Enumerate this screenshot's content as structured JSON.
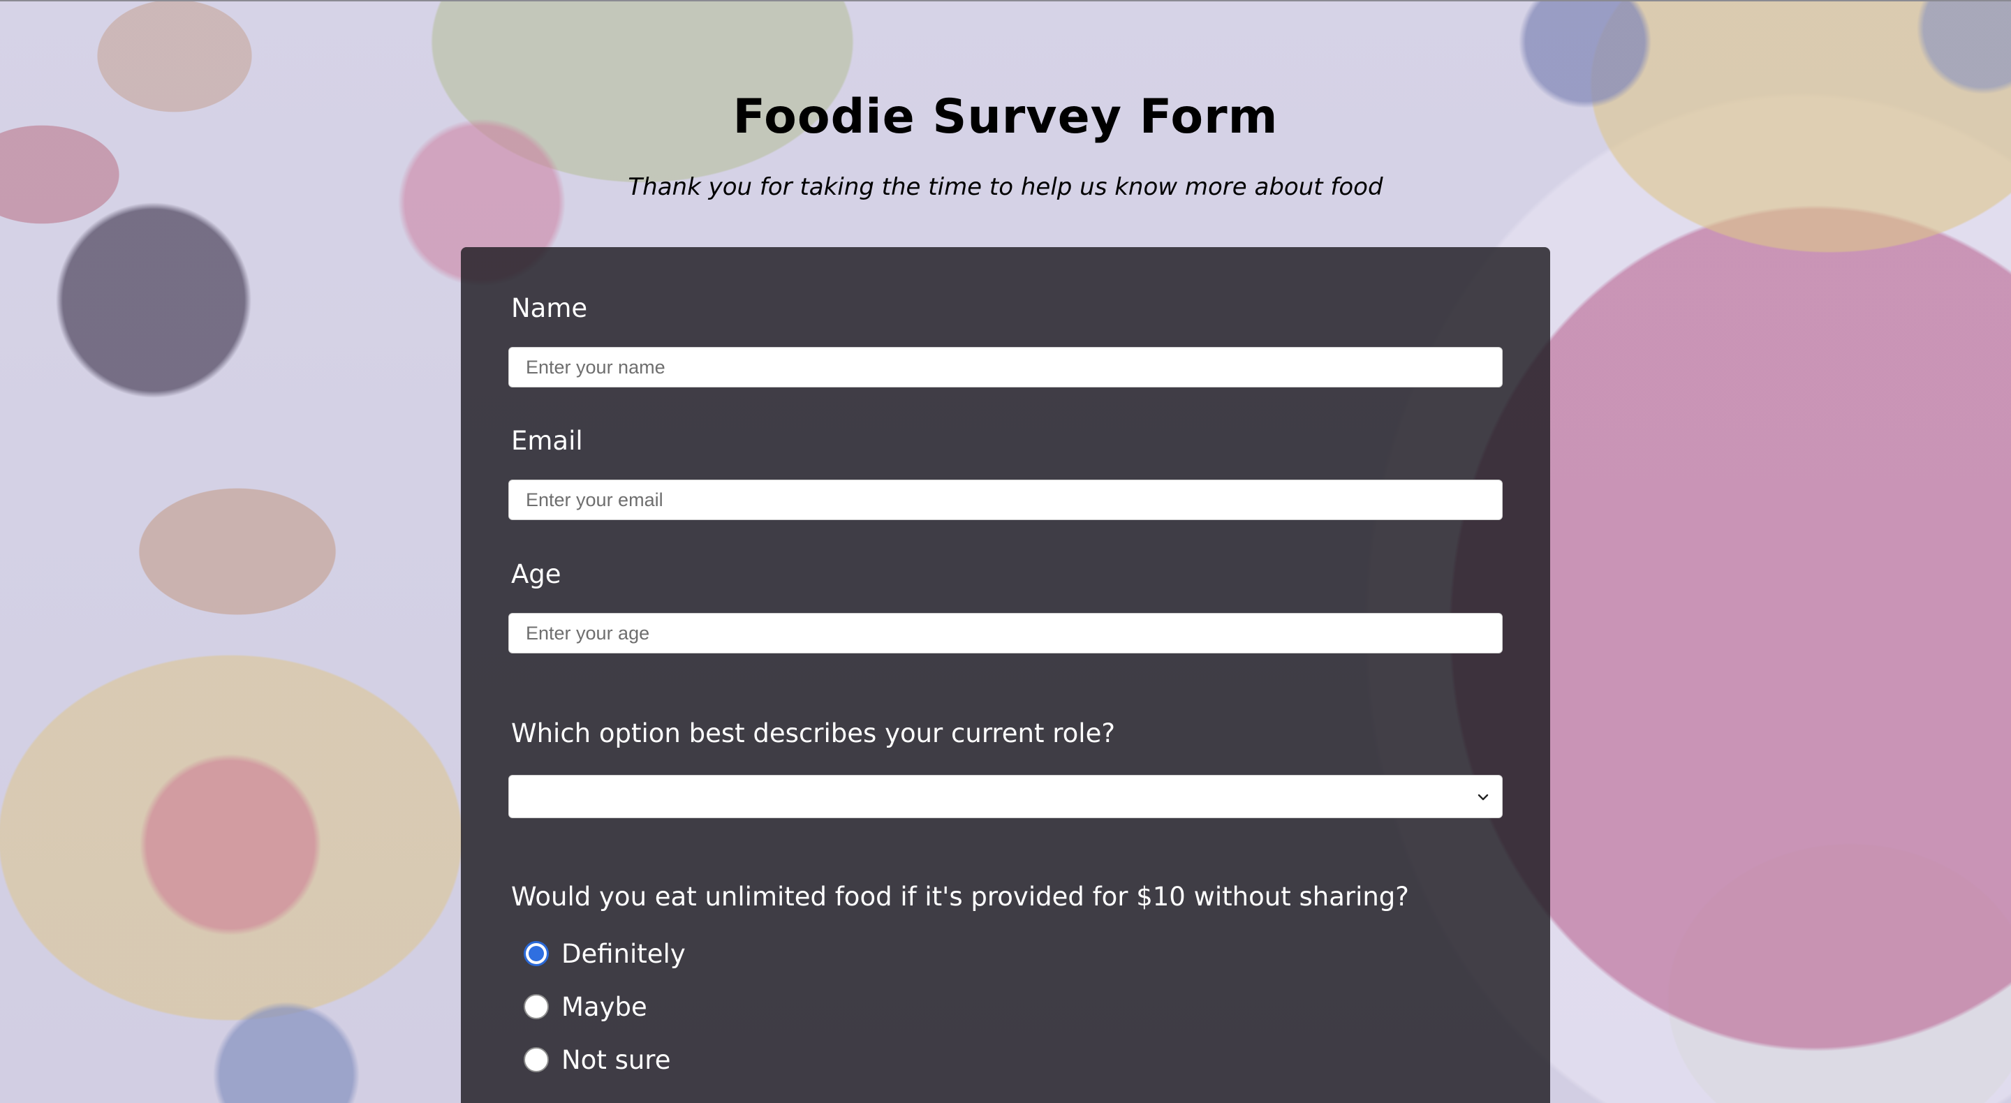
{
  "header": {
    "title": "Foodie Survey Form",
    "subtitle": "Thank you for taking the time to help us know more about food"
  },
  "form": {
    "name": {
      "label": "Name",
      "placeholder": "Enter your name",
      "value": ""
    },
    "email": {
      "label": "Email",
      "placeholder": "Enter your email",
      "value": ""
    },
    "age": {
      "label": "Age",
      "placeholder": "Enter your age",
      "value": ""
    },
    "role": {
      "question": "Which option best describes your current role?",
      "selected": ""
    },
    "unlimited_food": {
      "question": "Would you eat unlimited food if it's provided for $10 without sharing?",
      "options": [
        {
          "label": "Definitely",
          "checked": true
        },
        {
          "label": "Maybe",
          "checked": false
        },
        {
          "label": "Not sure",
          "checked": false
        }
      ]
    }
  },
  "colors": {
    "card_background": "#1e1c22",
    "radio_accent": "#2f6fe0",
    "text_on_card": "#ffffff"
  },
  "icons": {
    "select_arrow": "chevron-down-icon"
  }
}
